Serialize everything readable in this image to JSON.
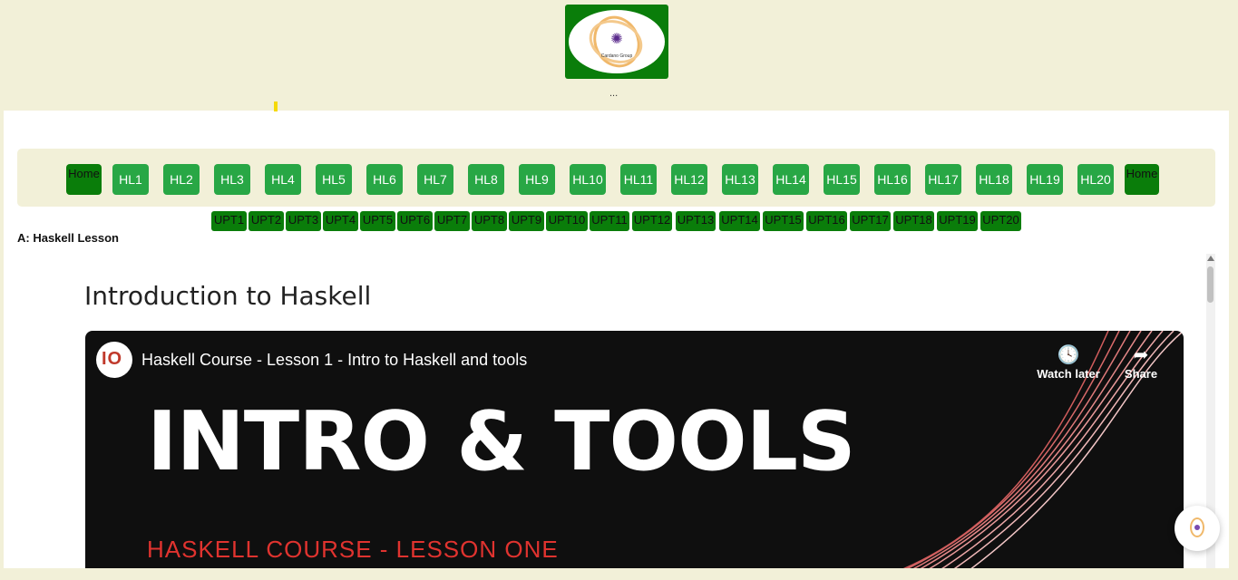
{
  "header": {
    "logo_text": "Cardano Group",
    "ellipsis": "..."
  },
  "nav": {
    "home_label": "Home",
    "lessons": [
      "HL1",
      "HL2",
      "HL3",
      "HL4",
      "HL5",
      "HL6",
      "HL7",
      "HL8",
      "HL9",
      "HL10",
      "HL11",
      "HL12",
      "HL13",
      "HL14",
      "HL15",
      "HL16",
      "HL17",
      "HL18",
      "HL19",
      "HL20"
    ],
    "home_end_label": "Home"
  },
  "upt": [
    "UPT1",
    "UPT2",
    "UPT3",
    "UPT4",
    "UPT5",
    "UPT6",
    "UPT7",
    "UPT8",
    "UPT9",
    "UPT10",
    "UPT11",
    "UPT12",
    "UPT13",
    "UPT14",
    "UPT15",
    "UPT16",
    "UPT17",
    "UPT18",
    "UPT19",
    "UPT20"
  ],
  "section_label": "A: Haskell Lesson",
  "lesson_title": "Introduction to Haskell",
  "video": {
    "channel_logo": "IO",
    "title": "Haskell Course - Lesson 1 - Intro to Haskell and tools",
    "watch_later": "Watch later",
    "share": "Share",
    "big_title": "INTRO & TOOLS",
    "sub_title": "HASKELL COURSE - LESSON ONE"
  },
  "colors": {
    "header_bg": "#f2f0d8",
    "nav_btn": "#28a745",
    "home_btn": "#0a7d0a",
    "upt_btn": "#0a7d0a",
    "video_accent": "#e0332f"
  }
}
